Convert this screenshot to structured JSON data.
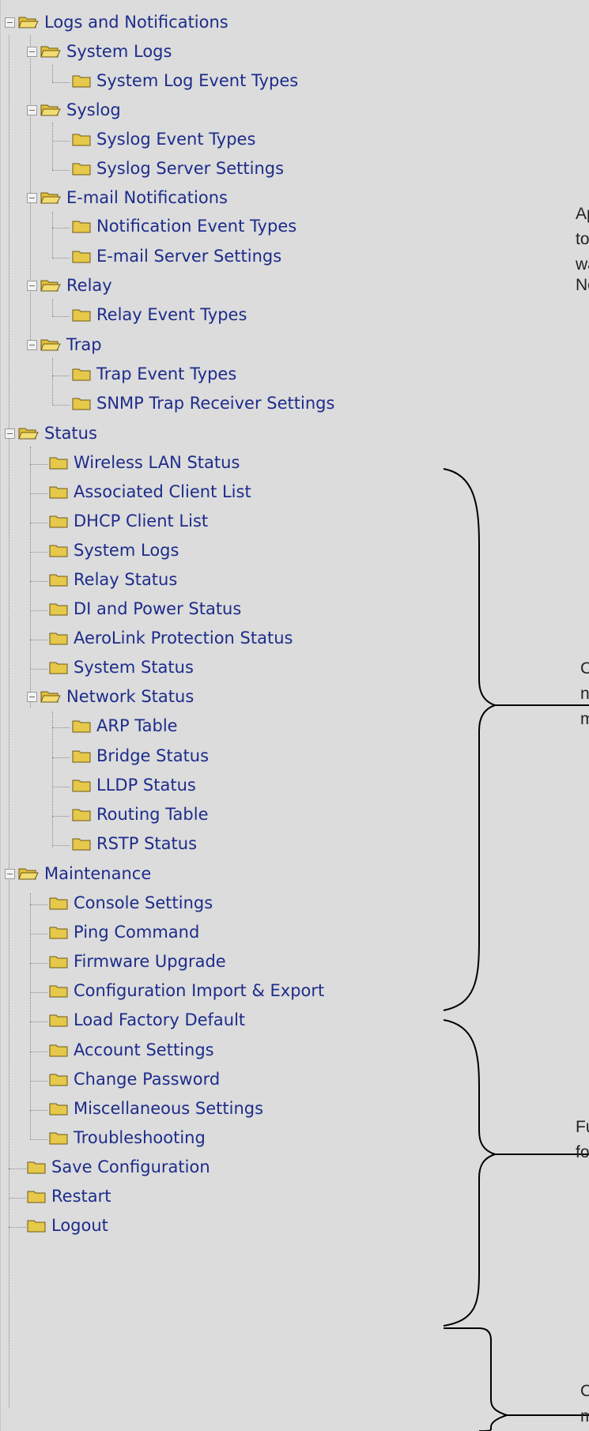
{
  "tree": {
    "logs_and_notifications": {
      "label": "Logs and Notifications",
      "system_logs": {
        "label": "System Logs",
        "items": [
          "System Log Event Types"
        ]
      },
      "syslog": {
        "label": "Syslog",
        "items": [
          "Syslog Event Types",
          "Syslog Server Settings"
        ]
      },
      "email_notifications": {
        "label": "E-mail Notifications",
        "items": [
          "Notification Event Types",
          "E-mail Server Settings"
        ]
      },
      "relay": {
        "label": "Relay",
        "items": [
          "Relay Event Types"
        ]
      },
      "trap": {
        "label": "Trap",
        "items": [
          "Trap Event Types",
          "SNMP Trap Receiver Settings"
        ]
      }
    },
    "status": {
      "label": "Status",
      "items": [
        "Wireless LAN Status",
        "Associated Client List",
        "DHCP Client List",
        "System Logs",
        "Relay Status",
        "DI and Power Status",
        "AeroLink Protection Status",
        "System Status"
      ],
      "network_status": {
        "label": "Network Status",
        "items": [
          "ARP Table",
          "Bridge Status",
          "LLDP Status",
          "Routing Table",
          "RSTP Status"
        ]
      }
    },
    "maintenance": {
      "label": "Maintenance",
      "items": [
        "Console Settings",
        "Ping Command",
        "Firmware Upgrade",
        "Configuration Import & Export",
        "Load Factory Default",
        "Account Settings",
        "Change Password",
        "Miscellaneous Settings",
        "Troubleshooting"
      ]
    },
    "bottom_items": [
      "Save Configuration",
      "Restart",
      "Logout"
    ]
  },
  "side_notes": {
    "note1_lines": [
      "Ap",
      "to",
      "wa"
    ],
    "note2": "No",
    "note3_lines": [
      "C",
      "n",
      "m"
    ],
    "note4_lines": [
      "Fu",
      "fo"
    ],
    "note5_lines": [
      "C",
      "m"
    ]
  },
  "colors": {
    "panel_background": "#dcdcdc",
    "link_text": "#1d2c8a",
    "folder_icon": "#e6c84a"
  },
  "icons": {
    "folder_open": "folder-open-icon",
    "folder_closed": "folder-icon",
    "collapse": "collapse-minus-icon"
  }
}
